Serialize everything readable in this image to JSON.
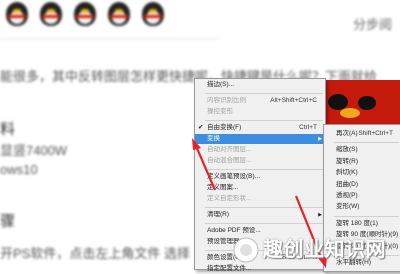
{
  "article": {
    "header_right": "分步阅",
    "line1": "能很多，其中反转图层怎样更快捷呢，快捷键是什么呢？下面就给",
    "heading_tools": "料",
    "line_hw": "显竖7400W",
    "line_os": "ows10",
    "heading_steps": "骤",
    "line_step1": "开PS软件，点击左上角文件 选择"
  },
  "menu_main": {
    "items": [
      {
        "label": "描边(S)...",
        "shortcut": "",
        "state": "normal"
      },
      {
        "label": "内容识别比例",
        "shortcut": "Alt+Shift+Ctrl+C",
        "state": "disabled"
      },
      {
        "label": "操控变形",
        "shortcut": "",
        "state": "disabled"
      },
      {
        "label": "自由变换(F)",
        "shortcut": "Ctrl+T",
        "state": "normal",
        "checked": true
      },
      {
        "label": "变换",
        "shortcut": "",
        "state": "highlighted",
        "submenu": true
      },
      {
        "label": "自动对齐图层...",
        "shortcut": "",
        "state": "disabled"
      },
      {
        "label": "自动混合图层...",
        "shortcut": "",
        "state": "disabled"
      },
      {
        "label": "定义画笔预设(B)...",
        "shortcut": "",
        "state": "normal"
      },
      {
        "label": "定义图案...",
        "shortcut": "",
        "state": "normal"
      },
      {
        "label": "定义自定形状...",
        "shortcut": "",
        "state": "disabled"
      },
      {
        "label": "清理(R)",
        "shortcut": "",
        "state": "normal",
        "submenu": true
      },
      {
        "label": "Adobe PDF 预设...",
        "shortcut": "",
        "state": "normal"
      },
      {
        "label": "预设管理器(M)...",
        "shortcut": "",
        "state": "normal"
      },
      {
        "label": "颜色设置(G)...",
        "shortcut": "Shift+Ctrl+K",
        "state": "normal"
      },
      {
        "label": "指定配置文件...",
        "shortcut": "",
        "state": "normal"
      }
    ]
  },
  "menu_sub": {
    "items": [
      {
        "label": "再次(A)",
        "shortcut": "Shift+Ctrl+T"
      },
      {
        "label": "缩放(S)",
        "shortcut": ""
      },
      {
        "label": "旋转(R)",
        "shortcut": ""
      },
      {
        "label": "斜切(K)",
        "shortcut": ""
      },
      {
        "label": "扭曲(D)",
        "shortcut": ""
      },
      {
        "label": "透视(P)",
        "shortcut": ""
      },
      {
        "label": "变形(W)",
        "shortcut": ""
      },
      {
        "label": "旋转 180 度(1)",
        "shortcut": ""
      },
      {
        "label": "旋转 90 度(顺时针)(9)",
        "shortcut": ""
      },
      {
        "label": "旋转 90 度(逆时针)(0)",
        "shortcut": ""
      },
      {
        "label": "水平翻转(H)",
        "shortcut": ""
      }
    ]
  },
  "watermark": "趣创业知识网",
  "colors": {
    "highlight": "#3d8ee0",
    "menu_bg": "#f0f0f0",
    "arrow": "#e8202a",
    "canvas_red": "#c41a0c"
  }
}
